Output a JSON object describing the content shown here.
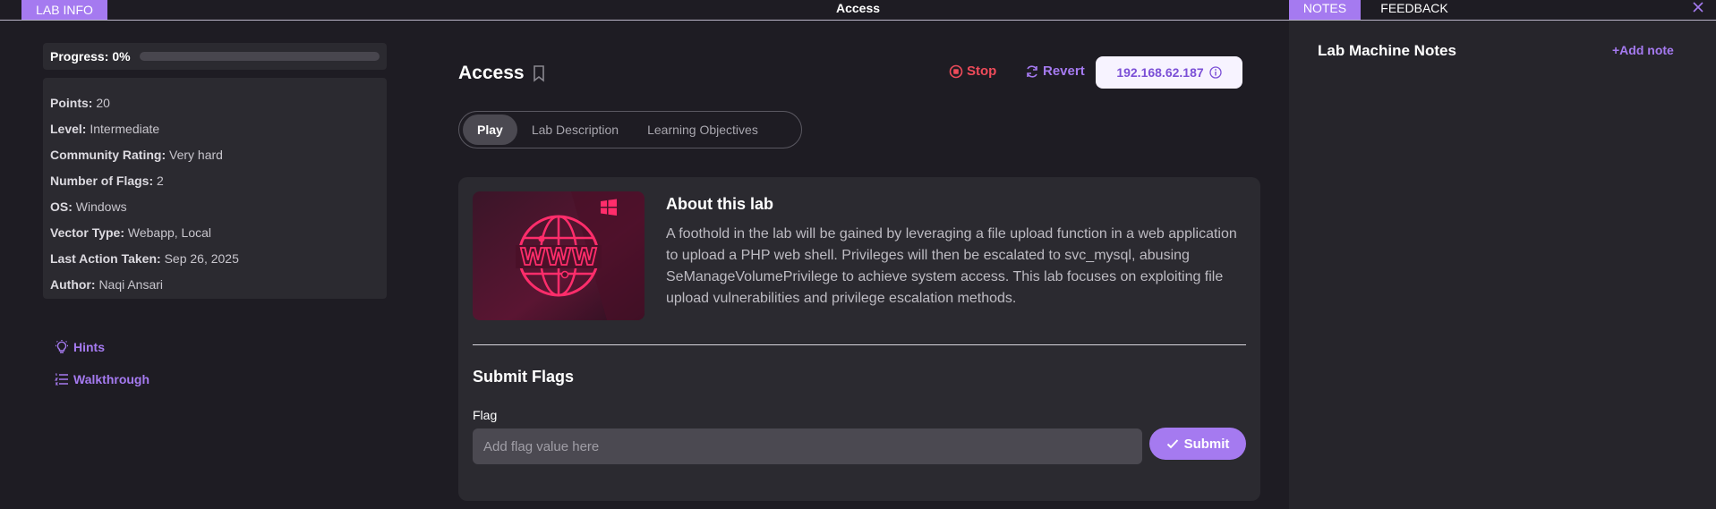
{
  "topbar": {
    "lab_info_tab": "LAB INFO",
    "title": "Access",
    "notes_tab": "NOTES",
    "feedback_tab": "FEEDBACK"
  },
  "progress": {
    "label": "Progress:",
    "value": "0%",
    "fraction": 0
  },
  "info": {
    "points": {
      "key": "Points:",
      "value": "20"
    },
    "level": {
      "key": "Level:",
      "value": "Intermediate"
    },
    "rating": {
      "key": "Community Rating:",
      "value": "Very hard"
    },
    "flags": {
      "key": "Number of Flags:",
      "value": "2"
    },
    "os": {
      "key": "OS:",
      "value": "Windows"
    },
    "vector": {
      "key": "Vector Type:",
      "value": "Webapp, Local"
    },
    "last_action": {
      "key": "Last Action Taken:",
      "value": "Sep 26, 2025"
    },
    "author": {
      "key": "Author:",
      "value": "Naqi Ansari"
    }
  },
  "sidebar_links": {
    "hints": "Hints",
    "walkthrough": "Walkthrough"
  },
  "main": {
    "title": "Access",
    "stop": "Stop",
    "revert": "Revert",
    "ip": "192.168.62.187",
    "tabs": [
      "Play",
      "Lab Description",
      "Learning Objectives"
    ],
    "active_tab": "Play"
  },
  "about": {
    "title": "About this lab",
    "text": "A foothold in the lab will be gained by leveraging a file upload function in a web application to upload a PHP web shell. Privileges will then be escalated to svc_mysql, abusing SeManageVolumePrivilege to achieve system access. This lab focuses on exploiting file upload vulnerabilities and privilege escalation methods."
  },
  "flags_form": {
    "title": "Submit Flags",
    "label": "Flag",
    "placeholder": "Add flag value here",
    "submit": "Submit"
  },
  "notes": {
    "title": "Lab Machine Notes",
    "add": "+Add note"
  },
  "colors": {
    "accent": "#a57af0",
    "stop": "#ef4b5a",
    "background": "#1e1c23",
    "panel": "#2b2a30"
  },
  "icons": {
    "close": "close-icon",
    "bookmark": "bookmark-icon",
    "stop": "stop-circle-icon",
    "revert": "refresh-icon",
    "info": "info-icon",
    "hints": "lightbulb-icon",
    "walkthrough": "list-icon",
    "windows": "windows-icon",
    "www": "www-globe-icon",
    "check": "check-icon"
  }
}
